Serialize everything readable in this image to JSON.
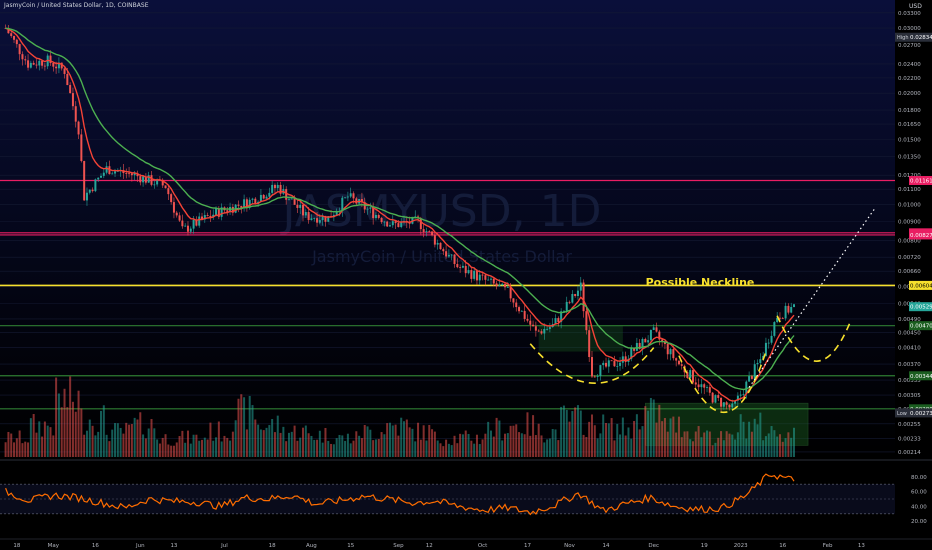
{
  "header": {
    "title": "JasmyCoin / United States Dollar, 1D, COINBASE",
    "currency": "USD"
  },
  "watermark": {
    "symbol": "JASMYUSD, 1D",
    "name": "JasmyCoin / United States Dollar"
  },
  "annotation": {
    "neckline_label": "Possible Neckline"
  },
  "price_axis": {
    "ticks": [
      "0.03300",
      "0.03000",
      "0.02700",
      "0.02400",
      "0.02200",
      "0.02000",
      "0.01800",
      "0.01650",
      "0.01500",
      "0.01350",
      "0.01200",
      "0.01100",
      "0.01000",
      "0.00900",
      "0.00800",
      "0.00720",
      "0.00660",
      "0.00600",
      "0.00540",
      "0.00490",
      "0.00450",
      "0.00410",
      "0.00370",
      "0.00335",
      "0.00305",
      "0.00280",
      "0.00255",
      "0.00233",
      "0.00214"
    ],
    "badges": [
      {
        "text": "High",
        "value": "0.02834",
        "color": "#2a2e39",
        "kind": "hl"
      },
      {
        "text": "",
        "value": "0.01161",
        "color": "#e91e63",
        "kind": "level"
      },
      {
        "text": "",
        "value": "0.00838",
        "color": "#e91e63",
        "kind": "level"
      },
      {
        "text": "",
        "value": "0.00827",
        "color": "#e91e63",
        "kind": "level"
      },
      {
        "text": "",
        "value": "0.00604",
        "color": "#f7e02d",
        "kind": "yellow"
      },
      {
        "text": "",
        "value": "0.00529",
        "color": "#26a69a",
        "kind": "last"
      },
      {
        "text": "",
        "value": "0.00470",
        "color": "#1b5e20",
        "kind": "level"
      },
      {
        "text": "",
        "value": "0.00344",
        "color": "#1b5e20",
        "kind": "level"
      },
      {
        "text": "",
        "value": "0.00280",
        "color": "#1b5e20",
        "kind": "level"
      },
      {
        "text": "Low",
        "value": "0.00273",
        "color": "#2a2e39",
        "kind": "hl"
      }
    ]
  },
  "time_axis": [
    "18",
    "May",
    "16",
    "Jun",
    "13",
    "Jul",
    "18",
    "Aug",
    "15",
    "Sep",
    "12",
    "Oct",
    "17",
    "Nov",
    "14",
    "Dec",
    "19",
    "2023",
    "16",
    "Feb",
    "13"
  ],
  "rsi_axis": [
    "80.00",
    "60.00",
    "40.00",
    "20.00"
  ],
  "colors": {
    "background_top": "#0a0f3a",
    "background_bottom": "#000000",
    "up": "#26a69a",
    "down": "#ef5350",
    "ema_fast": "#f44336",
    "ema_slow": "#4caf50",
    "rsi": "#ff6d00",
    "level_pink": "#e91e63",
    "level_green": "#2e7d32",
    "neckline": "#f7e02d"
  },
  "chart_data": {
    "type": "candlestick",
    "symbol": "JASMYUSD",
    "interval": "1D",
    "exchange": "COINBASE",
    "scale": "log",
    "price_range": [
      0.0021,
      0.034
    ],
    "high": 0.02834,
    "low": 0.00273,
    "last": 0.00529,
    "horizontal_levels": [
      {
        "value": 0.01161,
        "color": "pink"
      },
      {
        "value": 0.00838,
        "color": "pink"
      },
      {
        "value": 0.00827,
        "color": "pink"
      },
      {
        "value": 0.00604,
        "color": "yellow",
        "label": "Possible Neckline"
      },
      {
        "value": 0.0047,
        "color": "green"
      },
      {
        "value": 0.00344,
        "color": "green"
      },
      {
        "value": 0.0028,
        "color": "green"
      }
    ],
    "close_path": [
      {
        "date": "2022-04-14",
        "close": 0.03
      },
      {
        "date": "2022-04-22",
        "close": 0.024
      },
      {
        "date": "2022-04-29",
        "close": 0.0245
      },
      {
        "date": "2022-05-05",
        "close": 0.023
      },
      {
        "date": "2022-05-10",
        "close": 0.016
      },
      {
        "date": "2022-05-12",
        "close": 0.0105
      },
      {
        "date": "2022-05-20",
        "close": 0.0125
      },
      {
        "date": "2022-05-30",
        "close": 0.012
      },
      {
        "date": "2022-06-10",
        "close": 0.0112
      },
      {
        "date": "2022-06-16",
        "close": 0.0085
      },
      {
        "date": "2022-06-28",
        "close": 0.0095
      },
      {
        "date": "2022-07-10",
        "close": 0.0102
      },
      {
        "date": "2022-07-20",
        "close": 0.0112
      },
      {
        "date": "2022-07-30",
        "close": 0.0093
      },
      {
        "date": "2022-08-07",
        "close": 0.0092
      },
      {
        "date": "2022-08-14",
        "close": 0.0105
      },
      {
        "date": "2022-08-20",
        "close": 0.0098
      },
      {
        "date": "2022-08-30",
        "close": 0.0088
      },
      {
        "date": "2022-09-08",
        "close": 0.009
      },
      {
        "date": "2022-09-14",
        "close": 0.008
      },
      {
        "date": "2022-09-22",
        "close": 0.0068
      },
      {
        "date": "2022-10-10",
        "close": 0.0058
      },
      {
        "date": "2022-10-20",
        "close": 0.0045
      },
      {
        "date": "2022-10-26",
        "close": 0.0047
      },
      {
        "date": "2022-11-05",
        "close": 0.006
      },
      {
        "date": "2022-11-09",
        "close": 0.0035
      },
      {
        "date": "2022-11-20",
        "close": 0.0038
      },
      {
        "date": "2022-12-01",
        "close": 0.0045
      },
      {
        "date": "2022-12-10",
        "close": 0.0037
      },
      {
        "date": "2022-12-22",
        "close": 0.003
      },
      {
        "date": "2022-12-29",
        "close": 0.0028
      },
      {
        "date": "2023-01-08",
        "close": 0.0038
      },
      {
        "date": "2023-01-14",
        "close": 0.005
      },
      {
        "date": "2023-01-20",
        "close": 0.00529
      }
    ],
    "volume_profile": [
      0.3,
      0.5,
      0.9,
      0.6,
      0.4,
      0.5,
      0.3,
      0.3,
      0.4,
      0.7,
      0.5,
      0.4,
      0.35,
      0.3,
      0.4,
      0.5,
      0.4,
      0.3,
      0.3,
      0.45,
      0.5,
      0.4,
      0.6,
      0.5,
      0.45,
      0.7,
      0.5,
      0.4,
      0.3,
      0.5,
      0.4,
      0.35,
      0.45,
      0.55
    ],
    "rsi": {
      "range": [
        0,
        100
      ],
      "levels": [
        70,
        50,
        30
      ],
      "values": [
        60,
        48,
        55,
        52,
        45,
        38,
        50,
        47,
        46,
        40,
        52,
        50,
        55,
        43,
        48,
        54,
        50,
        45,
        47,
        40,
        35,
        38,
        32,
        42,
        58,
        34,
        44,
        52,
        40,
        36,
        38,
        55,
        84,
        75
      ]
    }
  }
}
